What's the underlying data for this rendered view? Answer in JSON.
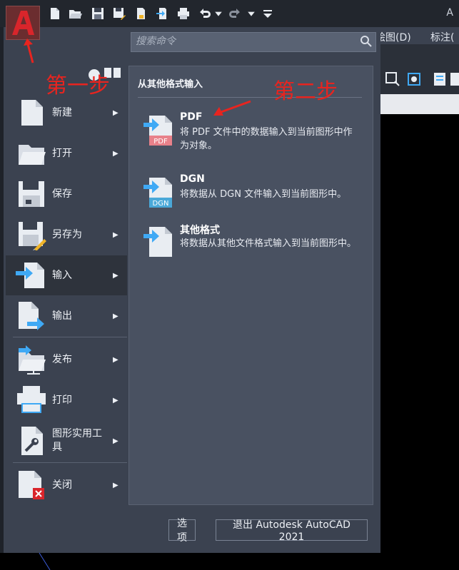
{
  "titlebar": {
    "title_fragment": "A"
  },
  "quick_access": {
    "icons": [
      "new-icon",
      "open-icon",
      "save-icon",
      "saveas-icon",
      "plot-preview-icon",
      "export-icon",
      "print-icon",
      "undo-icon",
      "undo-dropdown-icon",
      "redo-icon",
      "redo-dropdown-icon",
      "customize-icon"
    ]
  },
  "ribbon": {
    "tabs": [
      "绘图(D)",
      "标注("
    ]
  },
  "search": {
    "placeholder": "搜索命令"
  },
  "menu": {
    "items": [
      {
        "label": "新建",
        "icon": "new-document-icon",
        "has_submenu": true
      },
      {
        "label": "打开",
        "icon": "open-folder-icon",
        "has_submenu": true
      },
      {
        "label": "保存",
        "icon": "save-disk-icon",
        "has_submenu": false
      },
      {
        "label": "另存为",
        "icon": "save-as-icon",
        "has_submenu": true
      },
      {
        "label": "输入",
        "icon": "import-icon",
        "has_submenu": true,
        "active": true
      },
      {
        "label": "输出",
        "icon": "export-icon",
        "has_submenu": true
      },
      {
        "label": "发布",
        "icon": "publish-icon",
        "has_submenu": true
      },
      {
        "label": "打印",
        "icon": "printer-icon",
        "has_submenu": true
      },
      {
        "label": "图形实用工具",
        "icon": "drawing-utilities-icon",
        "has_submenu": true
      },
      {
        "label": "关闭",
        "icon": "close-document-icon",
        "has_submenu": true
      }
    ],
    "arrow": "▶"
  },
  "submenu": {
    "heading": "从其他格式输入",
    "items": [
      {
        "title": "PDF",
        "desc": "将 PDF 文件中的数据输入到当前图形中作为对象。",
        "badge": "PDF",
        "badge_color": "#e8818a"
      },
      {
        "title": "DGN",
        "desc": "将数据从 DGN 文件输入到当前图形中。",
        "badge": "DGN",
        "badge_color": "#4aa8d8"
      },
      {
        "title": "其他格式",
        "desc": "将数据从其他文件格式输入到当前图形中。",
        "badge": "",
        "badge_color": ""
      }
    ]
  },
  "footer": {
    "options_label": "选项",
    "exit_label": "退出 Autodesk AutoCAD 2021"
  },
  "annotations": {
    "step1": "第一步",
    "step2": "第二步"
  },
  "colors": {
    "accent_arrow": "#3fa9f5",
    "annotation_red": "#e8241f",
    "app_button": "#c0262b"
  }
}
